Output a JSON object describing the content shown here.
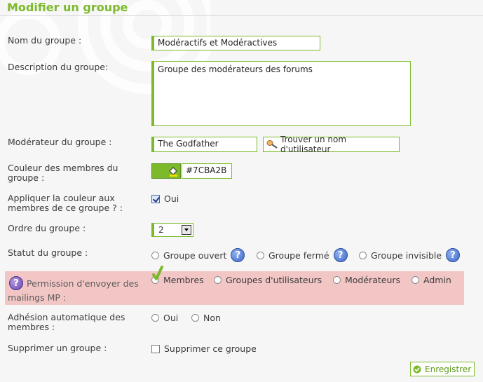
{
  "page": {
    "title": "Modifier un groupe"
  },
  "form": {
    "name": {
      "label": "Nom du groupe :",
      "value": "Modéractifs et Modéractives"
    },
    "description": {
      "label": "Description du groupe:",
      "value": "Groupe des modérateurs des forums"
    },
    "moderator": {
      "label": "Modérateur du groupe :",
      "value": "The Godfather",
      "find_button": "Trouver un nom d'utilisateur"
    },
    "color": {
      "label": "Couleur des membres du groupe :",
      "value": "#7CBA2B",
      "swatch": "#7cba2b"
    },
    "apply_color": {
      "label": "Appliquer la couleur aux membres de ce groupe ? :",
      "option": "Oui",
      "checked": true
    },
    "order": {
      "label": "Ordre du groupe :",
      "value": "2"
    },
    "status": {
      "label": "Statut du groupe :",
      "options": [
        "Groupe ouvert",
        "Groupe fermé",
        "Groupe invisible"
      ]
    },
    "mp_permission": {
      "label": "Permission d'envoyer des mailings MP :",
      "options": [
        "Membres",
        "Groupes d'utilisateurs",
        "Modérateurs",
        "Admin"
      ],
      "selected": "Membres"
    },
    "auto_join": {
      "label": "Adhésion automatique des membres :",
      "options": [
        "Oui",
        "Non"
      ]
    },
    "delete": {
      "label": "Supprimer un groupe :",
      "option": "Supprimer ce groupe",
      "checked": false
    },
    "save_button": "Enregistrer"
  },
  "colors": {
    "accent": "#7cba2b",
    "highlight": "#f3c6c6",
    "help_icon": "#3d67c9"
  }
}
